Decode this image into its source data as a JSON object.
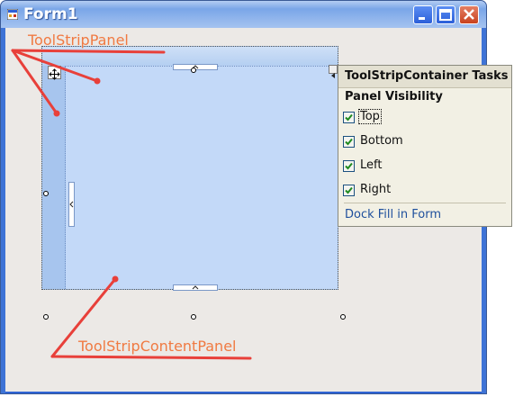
{
  "window": {
    "title": "Form1",
    "controls": {
      "minimize": "minimize",
      "maximize": "maximize",
      "close": "close"
    }
  },
  "tasks_panel": {
    "title": "ToolStripContainer Tasks",
    "section_label": "Panel Visibility",
    "options": [
      {
        "label": "Top",
        "checked": true
      },
      {
        "label": "Bottom",
        "checked": true
      },
      {
        "label": "Left",
        "checked": true
      },
      {
        "label": "Right",
        "checked": true
      }
    ],
    "link": "Dock Fill in Form"
  },
  "annotations": {
    "tool_strip_panel": "ToolStripPanel",
    "tool_strip_content_panel": "ToolStripContentPanel"
  },
  "colors": {
    "annotation_text": "#f07a42",
    "annotation_arrow": "#e8403a",
    "content_panel": "#c3d9f8",
    "tool_strip_panel": "#a9c8ee"
  },
  "icons": {
    "app": "form-app-icon",
    "move": "move-glyph-icon",
    "smart_tag": "smart-tag-arrow-icon"
  }
}
